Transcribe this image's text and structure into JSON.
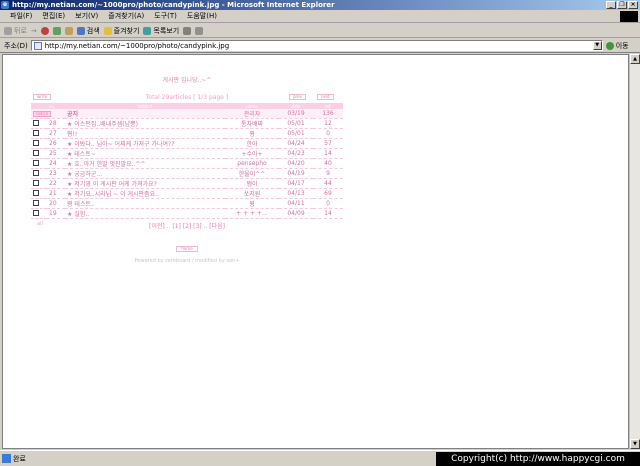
{
  "window": {
    "title": "http://my.netian.com/~1000pro/photo/candypink.jpg - Microsoft Internet Explorer"
  },
  "menu": [
    "파일(F)",
    "편집(E)",
    "보기(V)",
    "즐겨찾기(A)",
    "도구(T)",
    "도움말(H)"
  ],
  "toolbar": {
    "back": "뒤로",
    "forward": "→",
    "search": "검색",
    "favorites": "즐겨찾기",
    "history": "목록보기"
  },
  "address": {
    "label": "주소(D)",
    "url": "http://my.netian.com/~1000pro/photo/candypink.jpg",
    "go": "이동"
  },
  "status": {
    "text": "완료",
    "copyright": "Copyright(c) http://www.happycgi.com"
  },
  "board": {
    "title": "게시판 입니당..~^",
    "total": "Total 29articles [ 1/3 page ]",
    "btn_write": "write",
    "btn_prev": "prev",
    "btn_next": "next",
    "columns": [
      "no",
      "subject",
      "name",
      "date",
      "hit"
    ],
    "notice": {
      "badge": "notice",
      "subject": "공지",
      "name": "관리자",
      "date": "03/19",
      "hit": "136"
    },
    "rows": [
      {
        "no": "28",
        "subject": "★ 이스펀집..배내주셈(냠뿡)",
        "name": "통차배짜",
        "date": "05/01",
        "hit": "12"
      },
      {
        "no": "27",
        "subject": "뭥!!",
        "name": "뭥",
        "date": "05/01",
        "hit": "0"
      },
      {
        "no": "26",
        "subject": "★ 이봐다.. 님아~ 어찌케 가져구 가나여??",
        "name": "한아",
        "date": "04/24",
        "hit": "57"
      },
      {
        "no": "25",
        "subject": "★ 테스트~",
        "name": "+수아+",
        "date": "04/23",
        "hit": "14"
      },
      {
        "no": "24",
        "subject": "★ 호..아거 한말 멋진말요..^^",
        "name": "pensepho",
        "date": "04/20",
        "hit": "40"
      },
      {
        "no": "23",
        "subject": "★ 궁금하군...",
        "name": "한울이^^",
        "date": "04/19",
        "hit": "9"
      },
      {
        "no": "22",
        "subject": "★ 저기영 이 게시판 어케 가져가요?",
        "name": "쩡이",
        "date": "04/17",
        "hit": "44"
      },
      {
        "no": "21",
        "subject": "★ 저기요..시라님 ~ 이 게시판좀요..",
        "name": "쏘지원",
        "date": "04/13",
        "hit": "69"
      },
      {
        "no": "20",
        "subject": "뭥 테스트..",
        "name": "뭥",
        "date": "04/11",
        "hit": "0"
      },
      {
        "no": "19",
        "subject": "★ 실험..",
        "name": "+ + + +...",
        "date": "04/09",
        "hit": "14"
      }
    ],
    "pager": "[이전] .. [1] [2] [3] .. [다음]",
    "index_label": "all",
    "btn_home": "home",
    "powered": "Powered by zeroboard / modified by son+"
  }
}
